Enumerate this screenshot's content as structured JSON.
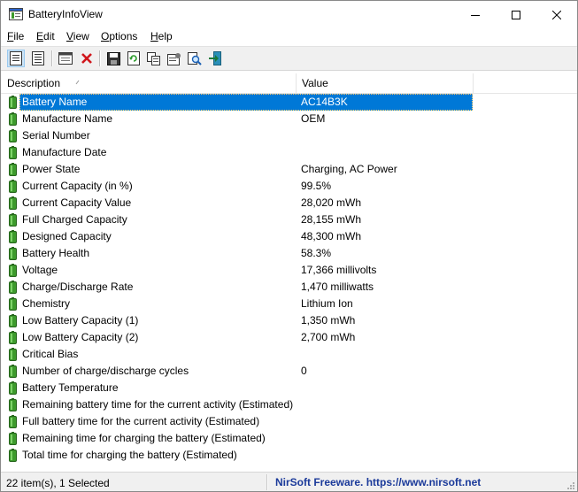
{
  "window": {
    "title": "BatteryInfoView"
  },
  "menu": [
    {
      "label": "File",
      "key": "F",
      "rest": "ile"
    },
    {
      "label": "Edit",
      "key": "E",
      "rest": "dit"
    },
    {
      "label": "View",
      "key": "V",
      "rest": "iew"
    },
    {
      "label": "Options",
      "key": "O",
      "rest": "ptions"
    },
    {
      "label": "Help",
      "key": "H",
      "rest": "elp"
    }
  ],
  "toolbar_icons": [
    "properties-view-icon",
    "log-view-icon",
    "html-report-icon",
    "delete-icon",
    "save-icon",
    "refresh-icon",
    "copy-icon",
    "properties-icon",
    "find-icon",
    "exit-icon"
  ],
  "columns": {
    "description": "Description",
    "value": "Value"
  },
  "rows": [
    {
      "desc": "Battery Name",
      "val": "AC14B3K"
    },
    {
      "desc": "Manufacture Name",
      "val": "OEM"
    },
    {
      "desc": "Serial Number",
      "val": ""
    },
    {
      "desc": "Manufacture Date",
      "val": ""
    },
    {
      "desc": "Power State",
      "val": "Charging, AC Power"
    },
    {
      "desc": "Current Capacity (in %)",
      "val": "99.5%"
    },
    {
      "desc": "Current Capacity Value",
      "val": "28,020 mWh"
    },
    {
      "desc": "Full Charged Capacity",
      "val": "28,155 mWh"
    },
    {
      "desc": "Designed Capacity",
      "val": "48,300 mWh"
    },
    {
      "desc": "Battery Health",
      "val": "58.3%"
    },
    {
      "desc": "Voltage",
      "val": "17,366 millivolts"
    },
    {
      "desc": "Charge/Discharge Rate",
      "val": "1,470 milliwatts"
    },
    {
      "desc": "Chemistry",
      "val": "Lithium Ion"
    },
    {
      "desc": "Low Battery Capacity (1)",
      "val": "1,350 mWh"
    },
    {
      "desc": "Low Battery Capacity (2)",
      "val": "2,700 mWh"
    },
    {
      "desc": "Critical Bias",
      "val": ""
    },
    {
      "desc": "Number of charge/discharge cycles",
      "val": "0"
    },
    {
      "desc": "Battery Temperature",
      "val": ""
    },
    {
      "desc": "Remaining battery time for the current activity (Estimated)",
      "val": ""
    },
    {
      "desc": "Full battery time for the current activity (Estimated)",
      "val": ""
    },
    {
      "desc": "Remaining time for charging the battery (Estimated)",
      "val": ""
    },
    {
      "desc": "Total  time for charging the battery (Estimated)",
      "val": ""
    }
  ],
  "selected_index": 0,
  "status": {
    "items": "22 item(s), 1 Selected",
    "credit": "NirSoft Freeware. https://www.nirsoft.net"
  },
  "colors": {
    "selection": "#0078d7",
    "battery_green": "#3d9a2c",
    "credit_text": "#1b3a9a"
  }
}
